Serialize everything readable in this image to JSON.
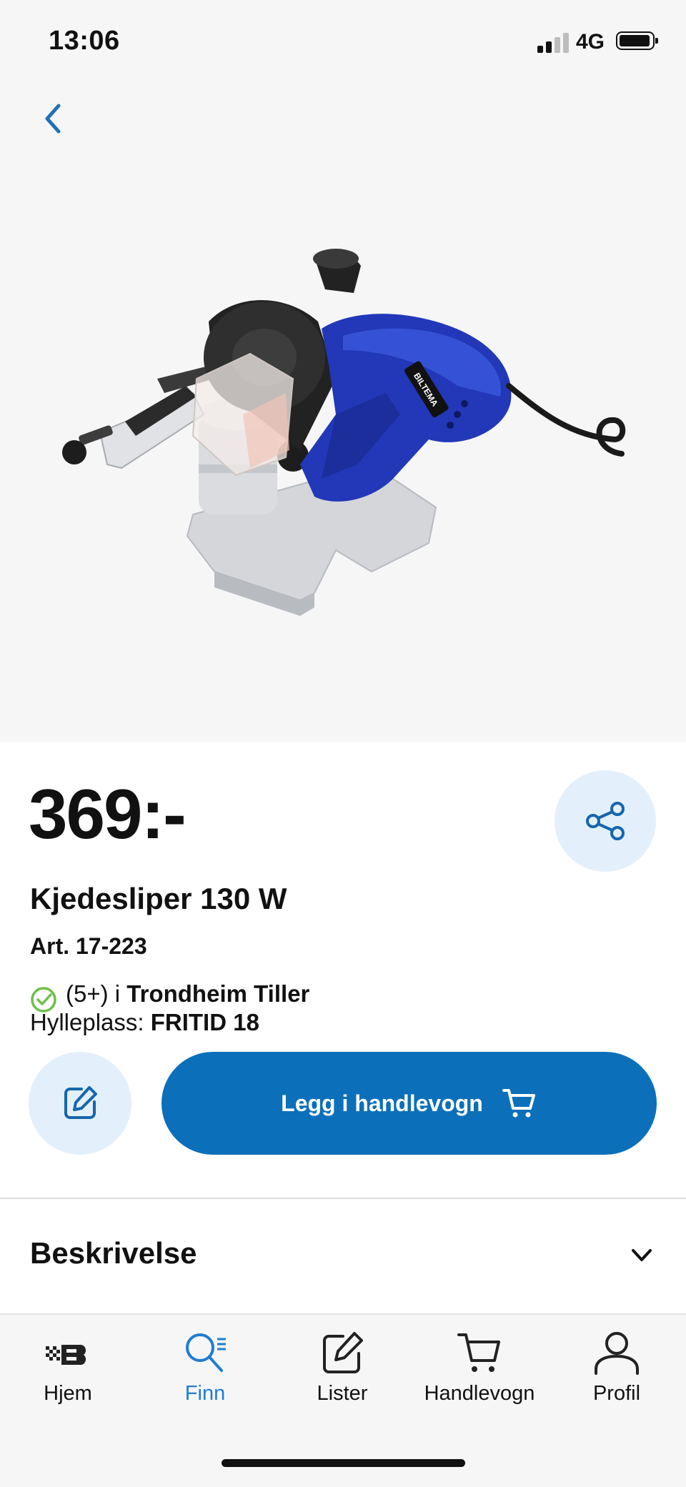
{
  "status_bar": {
    "time": "13:06",
    "network": "4G"
  },
  "product": {
    "price": "369:-",
    "name": "Kjedesliper 130 W",
    "article": "Art. 17-223",
    "stock_prefix": "(5+) i ",
    "store": "Trondheim Tiller",
    "shelf_label": "Hylleplass: ",
    "shelf_value": "FRITID 18",
    "device_brand": "BILTEMA"
  },
  "actions": {
    "add_to_cart": "Legg i handlevogn"
  },
  "sections": {
    "description": "Beskrivelse"
  },
  "tabbar": {
    "active": "Finn",
    "items": [
      {
        "label": "Hjem",
        "icon": "biltema-logo-icon"
      },
      {
        "label": "Finn",
        "icon": "search-icon"
      },
      {
        "label": "Lister",
        "icon": "edit-list-icon"
      },
      {
        "label": "Handlevogn",
        "icon": "cart-icon"
      },
      {
        "label": "Profil",
        "icon": "profile-icon"
      }
    ]
  },
  "colors": {
    "brand_blue": "#0c6fba",
    "light_blue": "#e3f0fb",
    "stock_green": "#6cc04a",
    "tab_active": "#1f7dcf"
  }
}
